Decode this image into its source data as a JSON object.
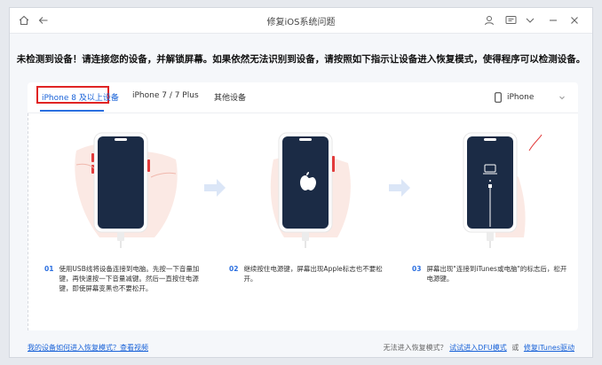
{
  "window": {
    "title": "修复iOS系统问题"
  },
  "notice": "未检测到设备！请连接您的设备，并解锁屏幕。如果依然无法识别到设备，请按照如下指示让设备进入恢复模式，使得程序可以检测设备。",
  "tabs": [
    {
      "label": "iPhone 8 及以上设备",
      "active": true
    },
    {
      "label": "iPhone 7 / 7 Plus",
      "active": false
    },
    {
      "label": "其他设备",
      "active": false
    }
  ],
  "device_select": {
    "value": "iPhone"
  },
  "steps": [
    {
      "num": "01",
      "text": "使用USB线将设备连接到电脑。先按一下音量加键，再快速按一下音量减键。然后一直按住电源键，即使屏幕变黑也不要松开。"
    },
    {
      "num": "02",
      "text": "继续按住电源键，屏幕出现Apple标志也不要松开。"
    },
    {
      "num": "03",
      "text": "屏幕出现\"连接到iTunes或电脑\"的标志后，松开电源键。"
    }
  ],
  "footer": {
    "help_link": "我的设备如何进入恢复模式？查看视频",
    "prefix": "无法进入恢复模式？",
    "dfu_link": "试试进入DFU模式",
    "or": "或",
    "itunes_link": "修复iTunes驱动"
  },
  "colors": {
    "accent": "#2b6fe0",
    "highlight": "#e02424"
  }
}
